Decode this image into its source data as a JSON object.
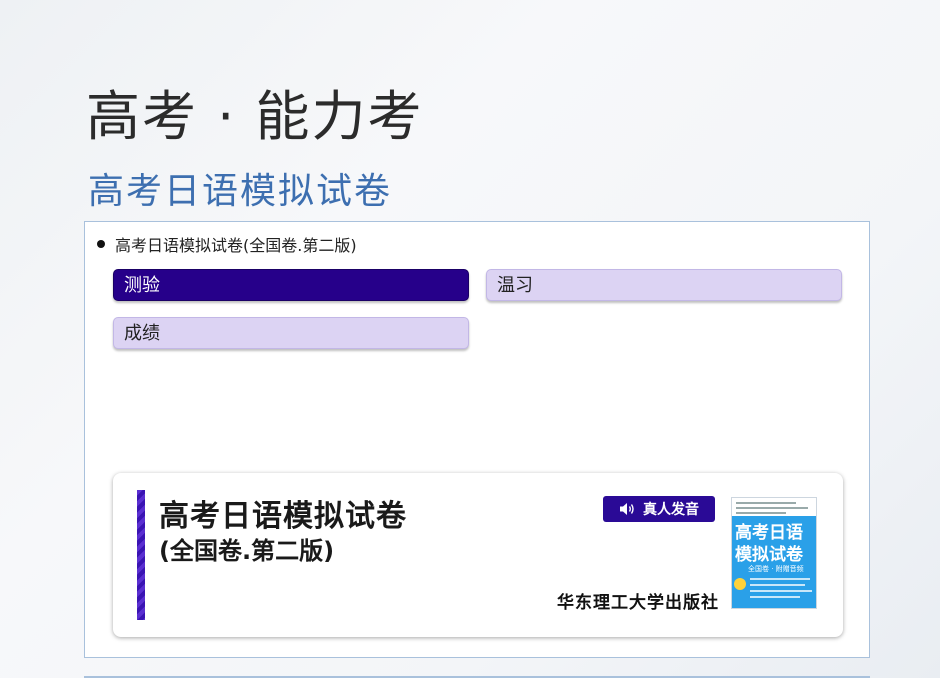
{
  "header": {
    "page_title": "高考 · 能力考",
    "section_title": "高考日语模拟试卷"
  },
  "panel": {
    "book_item": "高考日语模拟试卷(全国卷.第二版)",
    "tabs": [
      {
        "label": "测验",
        "active": true
      },
      {
        "label": "温习",
        "active": false
      },
      {
        "label": "成绩",
        "active": false
      }
    ]
  },
  "book_card": {
    "title": "高考日语模拟试卷",
    "subtitle": "(全国卷.第二版)",
    "audio_badge": "真人发音",
    "publisher": "华东理工大学出版社",
    "cover": {
      "title_line1": "高考日语",
      "title_line2": "模拟试卷",
      "note": "全国卷 · 附赠音频"
    }
  },
  "colors": {
    "accent": "#26008a",
    "tab_inactive": "#dcd3f3",
    "section_title": "#3d6fb0",
    "cover_blue": "#2aa0e8"
  },
  "icons": [
    "speaker-icon",
    "bullet-icon"
  ]
}
